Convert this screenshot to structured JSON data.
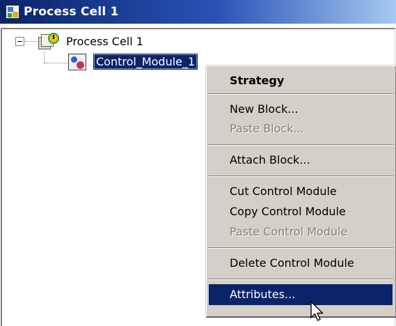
{
  "window": {
    "title": "Process Cell 1",
    "title_icon": "process-cell-window-icon"
  },
  "tree": {
    "root": {
      "label": "Process Cell 1",
      "icon": "process-cell-icon",
      "expanded": true
    },
    "child": {
      "label": "Control_Module_1",
      "icon": "control-module-icon",
      "selected": true
    }
  },
  "context_menu": {
    "items": [
      {
        "label": "Strategy",
        "style": "bold",
        "enabled": true
      },
      {
        "label": "New Block...",
        "enabled": true
      },
      {
        "label": "Paste Block...",
        "enabled": false
      },
      {
        "label": "Attach Block...",
        "enabled": true
      },
      {
        "label": "Cut Control Module",
        "enabled": true
      },
      {
        "label": "Copy Control Module",
        "enabled": true
      },
      {
        "label": "Paste Control Module",
        "enabled": false
      },
      {
        "label": "Delete Control Module",
        "enabled": true
      },
      {
        "label": "Attributes...",
        "enabled": true,
        "highlighted": true
      }
    ]
  },
  "colors": {
    "titlebar_start": "#0a246a",
    "titlebar_end": "#a6caf0",
    "selection": "#0a246a",
    "menu_background": "#d4d0c8",
    "disabled_text": "#808080"
  },
  "cursor": {
    "icon": "arrow-cursor-icon"
  }
}
